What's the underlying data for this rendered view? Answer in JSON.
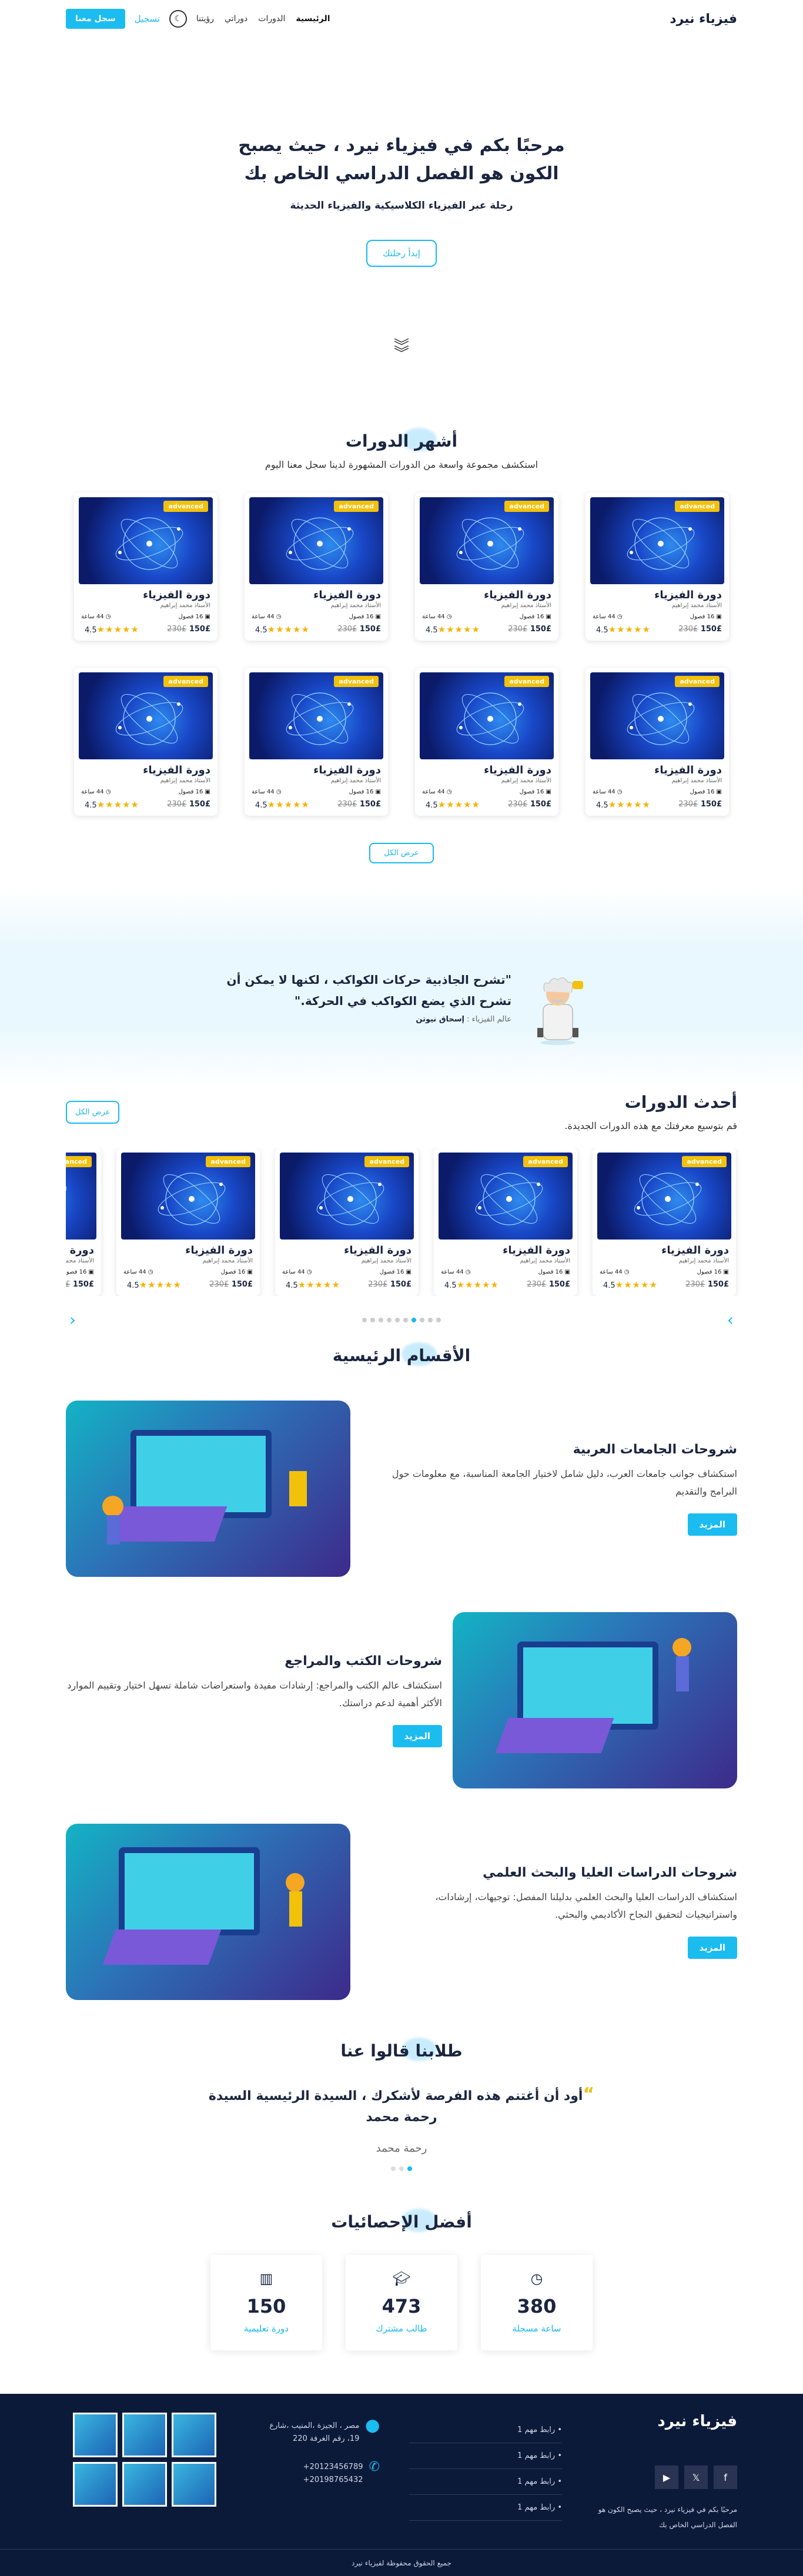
{
  "nav": {
    "logo": "فيزياء نيرد",
    "links": [
      "الرئيسية",
      "الدورات",
      "دوراتي",
      "رؤيتنا"
    ],
    "login": "تسجيل",
    "join": "سجل معنا"
  },
  "hero": {
    "title": "مرحبًا بكم في فيزياء نيرد ، حيث يصبح الكون هو الفصل الدراسي الخاص بك",
    "subtitle": "رحلة عبر الفيزياء الكلاسيكية والفيزياء الحديثة",
    "cta": "إبدأ رحلتك"
  },
  "popular": {
    "title": "أشهر الدورات",
    "subtitle": "استكشف مجموعة واسعة من الدورات المشهورة لدينا سجل معنا اليوم",
    "show_all": "عرض الكل"
  },
  "course": {
    "badge": "advanced",
    "title": "دورة الفيزياء",
    "teacher": "الأستاذ محمد إبراهيم",
    "hours": "44 ساعة",
    "lessons": "16 فصول",
    "price": "150£",
    "old_price": "230£",
    "rating": "4.5",
    "stars": "★★★★★"
  },
  "quote": {
    "text": "\"تشرح الجاذبية حركات الكواكب ، لكنها لا يمكن أن تشرح الذي يضع الكواكب في الحركة.\"",
    "author_prefix": "عالم الفيزياء :",
    "author": "إسحاق نيوتن"
  },
  "latest": {
    "title": "أحدث الدورات",
    "subtitle": "قم بتوسيع معرفتك مع هذه الدورات الجديدة.",
    "show_all": "عرض الكل"
  },
  "sections": {
    "title": "الأقسام الرئيسية",
    "items": [
      {
        "title": "شروحات الجامعات العربية",
        "text": "استكشاف جوانب جامعات العرب، دليل شامل لاختيار الجامعة المناسبة، مع معلومات حول البرامج والتقديم",
        "button": "المزيد"
      },
      {
        "title": "شروحات الكتب والمراجع",
        "text": "استكشاف عالم الكتب والمراجع: إرشادات مفيدة واستعراضات شاملة تسهل اختيار وتقييم الموارد الأكثر أهمية لدعم دراستك.",
        "button": "المزيد"
      },
      {
        "title": "شروحات الدراسات العليا والبحث العلمي",
        "text": "استكشاف الدراسات العليا والبحث العلمي بدليلنا المفصل: توجيهات، إرشادات، واستراتيجيات لتحقيق النجاح الأكاديمي والبحثي.",
        "button": "المزيد"
      }
    ]
  },
  "testimonials": {
    "title": "طلابنا قالوا عنا",
    "quote": "أود أن أغتنم هذه الفرصة لأشكرك ، السيدة الرئيسية السيدة رحمة محمد",
    "name": "رحمة محمد"
  },
  "stats": {
    "title": "أفضل الإحصائيات",
    "items": [
      {
        "num": "380",
        "label": "ساعة مسجلة",
        "icon": "clock-icon"
      },
      {
        "num": "473",
        "label": "طالب مشترك",
        "icon": "graduation-cap-icon"
      },
      {
        "num": "150",
        "label": "دورة تعليمية",
        "icon": "books-icon"
      }
    ]
  },
  "footer": {
    "logo": "فيزياء نيرد",
    "about": "مرحبًا بكم في فيزياء نيرد ، حيث يصبح الكون هو الفصل الدراسي الخاص بك",
    "links": [
      "رابط مهم 1",
      "رابط مهم 1",
      "رابط مهم 1",
      "رابط مهم 1"
    ],
    "address": "مصر ، الجيزة ،المنيب ،شارع 19، رقم الغرفة 220",
    "phone1": "20123456789+",
    "phone2": "20198765432+",
    "copyright": "جميع الحقوق محفوظة لفيزياء نيرد"
  },
  "colors": {
    "accent": "#1bbcf0",
    "dark": "#0c1a3a",
    "badge": "#f2c10b"
  }
}
